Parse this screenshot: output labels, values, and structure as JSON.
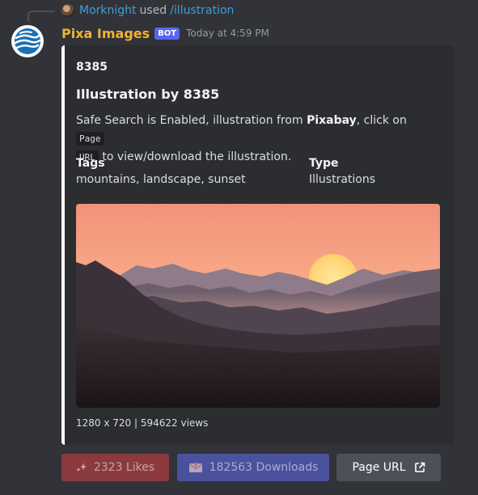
{
  "reply": {
    "username": "Morknight",
    "used_text": "used",
    "command": "/illustration",
    "avatar_icon": "user-avatar-icon"
  },
  "message": {
    "author": "Pixa Images",
    "badge": "BOT",
    "timestamp": "Today at 4:59 PM",
    "avatar_icon": "globe-logo-icon"
  },
  "embed": {
    "accent_color": "#ffffff",
    "author": "8385",
    "title": "Illustration by 8385",
    "description": {
      "part1": "Safe Search is Enabled, illustration from ",
      "bold": "Pixabay",
      "part2": ", click on ",
      "code1": "Page",
      "code2": "URL",
      "part3": " to view/download the illustration."
    },
    "fields": [
      {
        "name": "Tags",
        "value": "mountains, landscape, sunset"
      },
      {
        "name": "Type",
        "value": "Illustrations"
      }
    ],
    "footer": "1280 x 720 | 594622 views"
  },
  "buttons": {
    "likes": {
      "label": "2323 Likes",
      "icon": "sparkles-icon",
      "color": "#8b3a40"
    },
    "downloads": {
      "label": "182563 Downloads",
      "icon": "envelope-download-icon",
      "color": "#4a519d"
    },
    "page_url": {
      "label": "Page URL",
      "icon": "external-link-icon",
      "color": "#4e5058"
    }
  }
}
